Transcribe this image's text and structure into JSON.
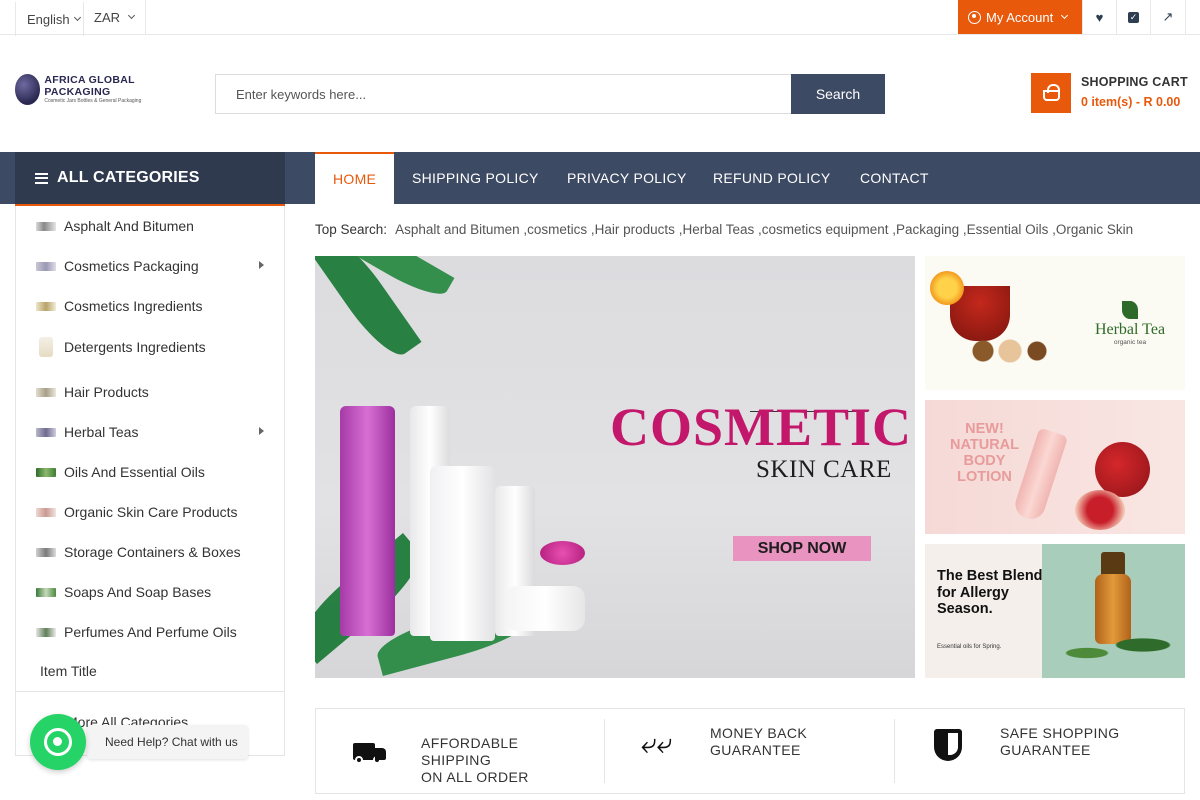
{
  "topbar": {
    "language": "English",
    "currency": "ZAR",
    "account_label": "My Account",
    "icons": [
      "heart-icon",
      "check-square-icon",
      "external-link-icon"
    ]
  },
  "header": {
    "logo_text": "AFRICA GLOBAL PACKAGING",
    "logo_tagline": "Cosmetic Jars Bottles & General Packaging",
    "search_placeholder": "Enter keywords here...",
    "search_button": "Search",
    "cart_title": "SHOPPING CART",
    "cart_summary": "0 item(s) - R 0.00"
  },
  "nav": {
    "categories_title": "ALL CATEGORIES",
    "items": [
      "HOME",
      "SHIPPING POLICY",
      "PRIVACY POLICY",
      "REFUND POLICY",
      "CONTACT"
    ],
    "active": "HOME"
  },
  "sidebar": {
    "categories": [
      {
        "label": "Asphalt And Bitumen",
        "has_sub": false
      },
      {
        "label": "Cosmetics Packaging",
        "has_sub": true
      },
      {
        "label": "Cosmetics Ingredients",
        "has_sub": false
      },
      {
        "label": "Detergents Ingredients",
        "has_sub": false
      },
      {
        "label": "Hair Products",
        "has_sub": false
      },
      {
        "label": "Herbal Teas",
        "has_sub": true
      },
      {
        "label": "Oils And Essential Oils",
        "has_sub": false
      },
      {
        "label": "Organic Skin Care Products",
        "has_sub": false
      },
      {
        "label": "Storage Containers & Boxes",
        "has_sub": false
      },
      {
        "label": "Soaps And Soap Bases",
        "has_sub": false
      },
      {
        "label": "Perfumes And Perfume Oils",
        "has_sub": false
      },
      {
        "label": "Item Title",
        "has_sub": false
      }
    ],
    "more_label": "More All Categories"
  },
  "top_search": {
    "label": "Top Search:",
    "terms": "Asphalt and Bitumen ,cosmetics ,Hair products ,Herbal Teas ,cosmetics equipment ,Packaging ,Essential Oils ,Organic Skin"
  },
  "banner": {
    "title": "COSMETIC",
    "subtitle": "SKIN CARE",
    "cta": "SHOP NOW"
  },
  "side_banners": {
    "tea_name": "Herbal Tea",
    "tea_sub": "organic tea",
    "lotion_text": "NEW! NATURAL BODY LOTION",
    "blend_text": "The Best Blend for Allergy Season.",
    "blend_sub": "Essential oils for Spring."
  },
  "features": [
    {
      "icon": "truck-icon",
      "line1": "AFFORDABLE",
      "line2": "SHIPPING",
      "line3": "ON ALL ORDER"
    },
    {
      "icon": "reply-all-icon",
      "line1": "MONEY BACK",
      "line2": "GUARANTEE",
      "line3": ""
    },
    {
      "icon": "shield-icon",
      "line1": "SAFE SHOPPING",
      "line2": "GUARANTEE",
      "line3": ""
    }
  ],
  "whatsapp": {
    "tooltip": "Need Help? Chat with us"
  },
  "colors": {
    "accent": "#e8590c",
    "nav_bg": "#3d4a63",
    "categories_bg": "#2f3a4f",
    "whatsapp": "#25d366"
  }
}
